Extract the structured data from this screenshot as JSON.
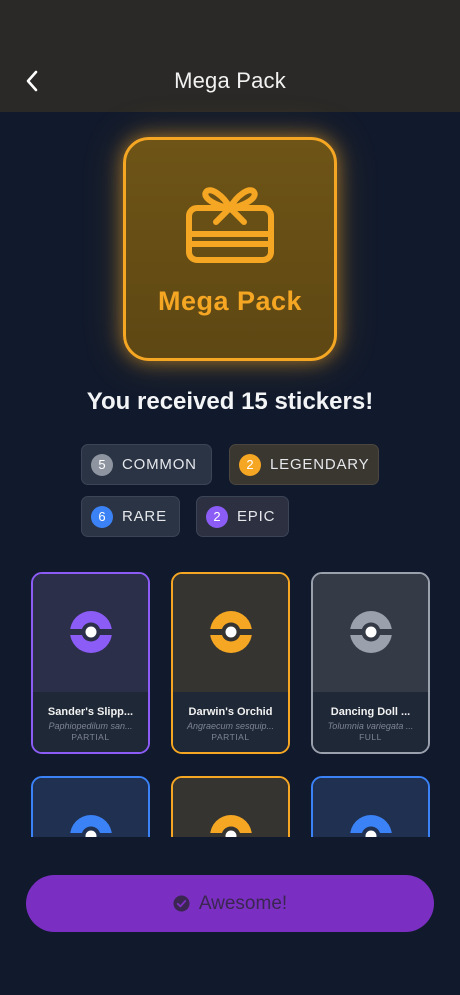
{
  "nav": {
    "title": "Mega Pack"
  },
  "pack": {
    "name": "Mega Pack"
  },
  "summary": {
    "text": "You received 15 stickers!"
  },
  "rarities": [
    {
      "count": "5",
      "label": "COMMON",
      "color": "#9aa1ad"
    },
    {
      "count": "2",
      "label": "LEGENDARY",
      "color": "#f5a623"
    },
    {
      "count": "6",
      "label": "RARE",
      "color": "#3b82f6"
    },
    {
      "count": "2",
      "label": "EPIC",
      "color": "#8b5cf6"
    }
  ],
  "stickers": [
    {
      "name": "Sander's Slipp...",
      "scientific": "Paphiopedilum san...",
      "status": "PARTIAL",
      "rarity": "EPIC",
      "color": "#8b5cf6"
    },
    {
      "name": "Darwin's Orchid",
      "scientific": "Angraecum sesquip...",
      "status": "PARTIAL",
      "rarity": "LEGENDARY",
      "color": "#f5a623"
    },
    {
      "name": "Dancing Doll ...",
      "scientific": "Tolumnia variegata ...",
      "status": "FULL",
      "rarity": "COMMON",
      "color": "#9aa1ad"
    },
    {
      "name": "",
      "scientific": "",
      "status": "",
      "rarity": "RARE",
      "color": "#3b82f6"
    },
    {
      "name": "",
      "scientific": "",
      "status": "",
      "rarity": "LEGENDARY",
      "color": "#f5a623"
    },
    {
      "name": "",
      "scientific": "",
      "status": "",
      "rarity": "RARE",
      "color": "#3b82f6"
    }
  ],
  "cta": {
    "label": "Awesome!",
    "icon": "check-circle-icon"
  },
  "colors": {
    "accent": "#7a2fc2",
    "legendary": "#f5a623",
    "background": "#111a2c"
  }
}
